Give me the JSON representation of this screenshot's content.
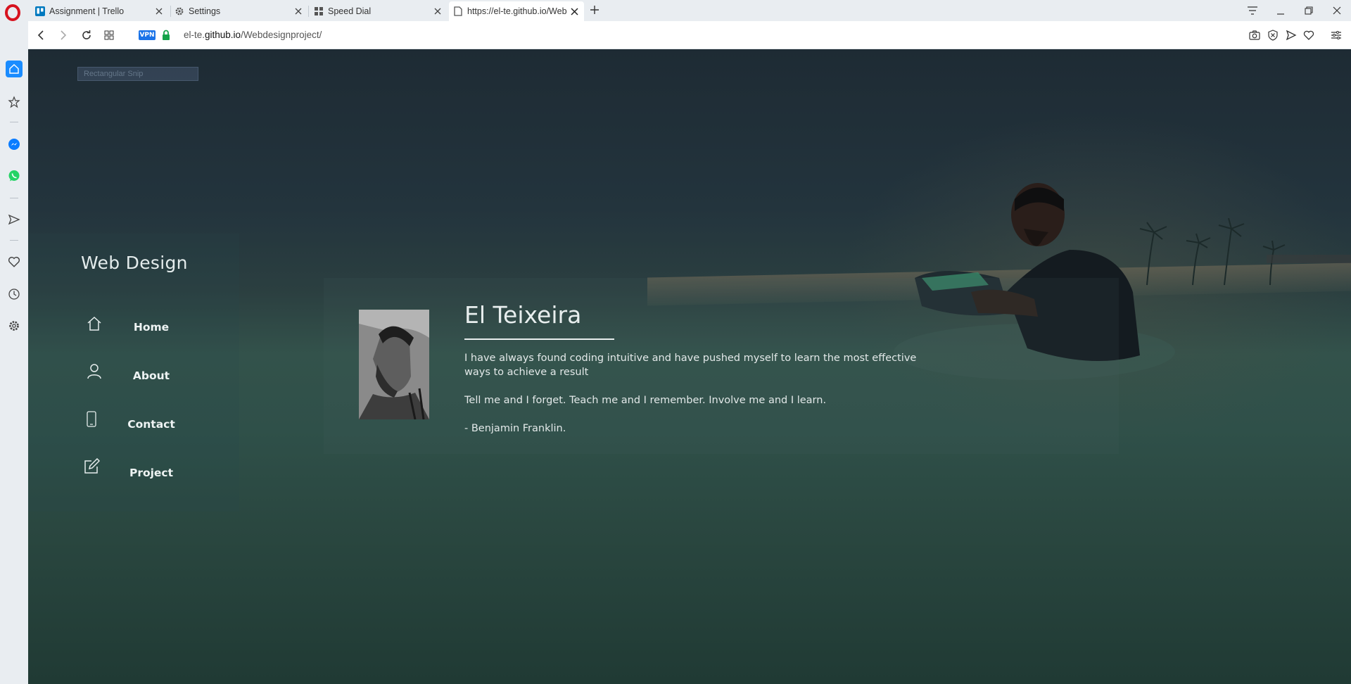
{
  "browser": {
    "tabs": [
      {
        "title": "Assignment | Trello",
        "icon": "trello-icon",
        "active": false
      },
      {
        "title": "Settings",
        "icon": "gear-icon",
        "active": false
      },
      {
        "title": "Speed Dial",
        "icon": "grid-icon",
        "active": false
      },
      {
        "title": "https://el-te.github.io/Web",
        "icon": "page-icon",
        "active": true
      }
    ],
    "vpn_label": "VPN",
    "url": {
      "prefix": "el-te.",
      "domain": "github.io",
      "path": "/Webdesignproject/"
    },
    "accent_color": "#1a73e8"
  },
  "overlay": {
    "snip_label": "Rectangular Snip"
  },
  "site": {
    "title": "Web Design",
    "menu": [
      {
        "label": "Home",
        "icon": "home-icon"
      },
      {
        "label": "About",
        "icon": "user-icon"
      },
      {
        "label": "Contact",
        "icon": "phone-icon"
      },
      {
        "label": "Project",
        "icon": "edit-icon"
      }
    ],
    "profile": {
      "name": "El Teixeira",
      "intro_line1": "I have always found coding intuitive and have pushed myself to learn the most effective",
      "intro_line2": "ways to achieve a result",
      "quote": "Tell me and I forget. Teach me and I remember. Involve me and I learn.",
      "attribution": "- Benjamin Franklin."
    }
  }
}
